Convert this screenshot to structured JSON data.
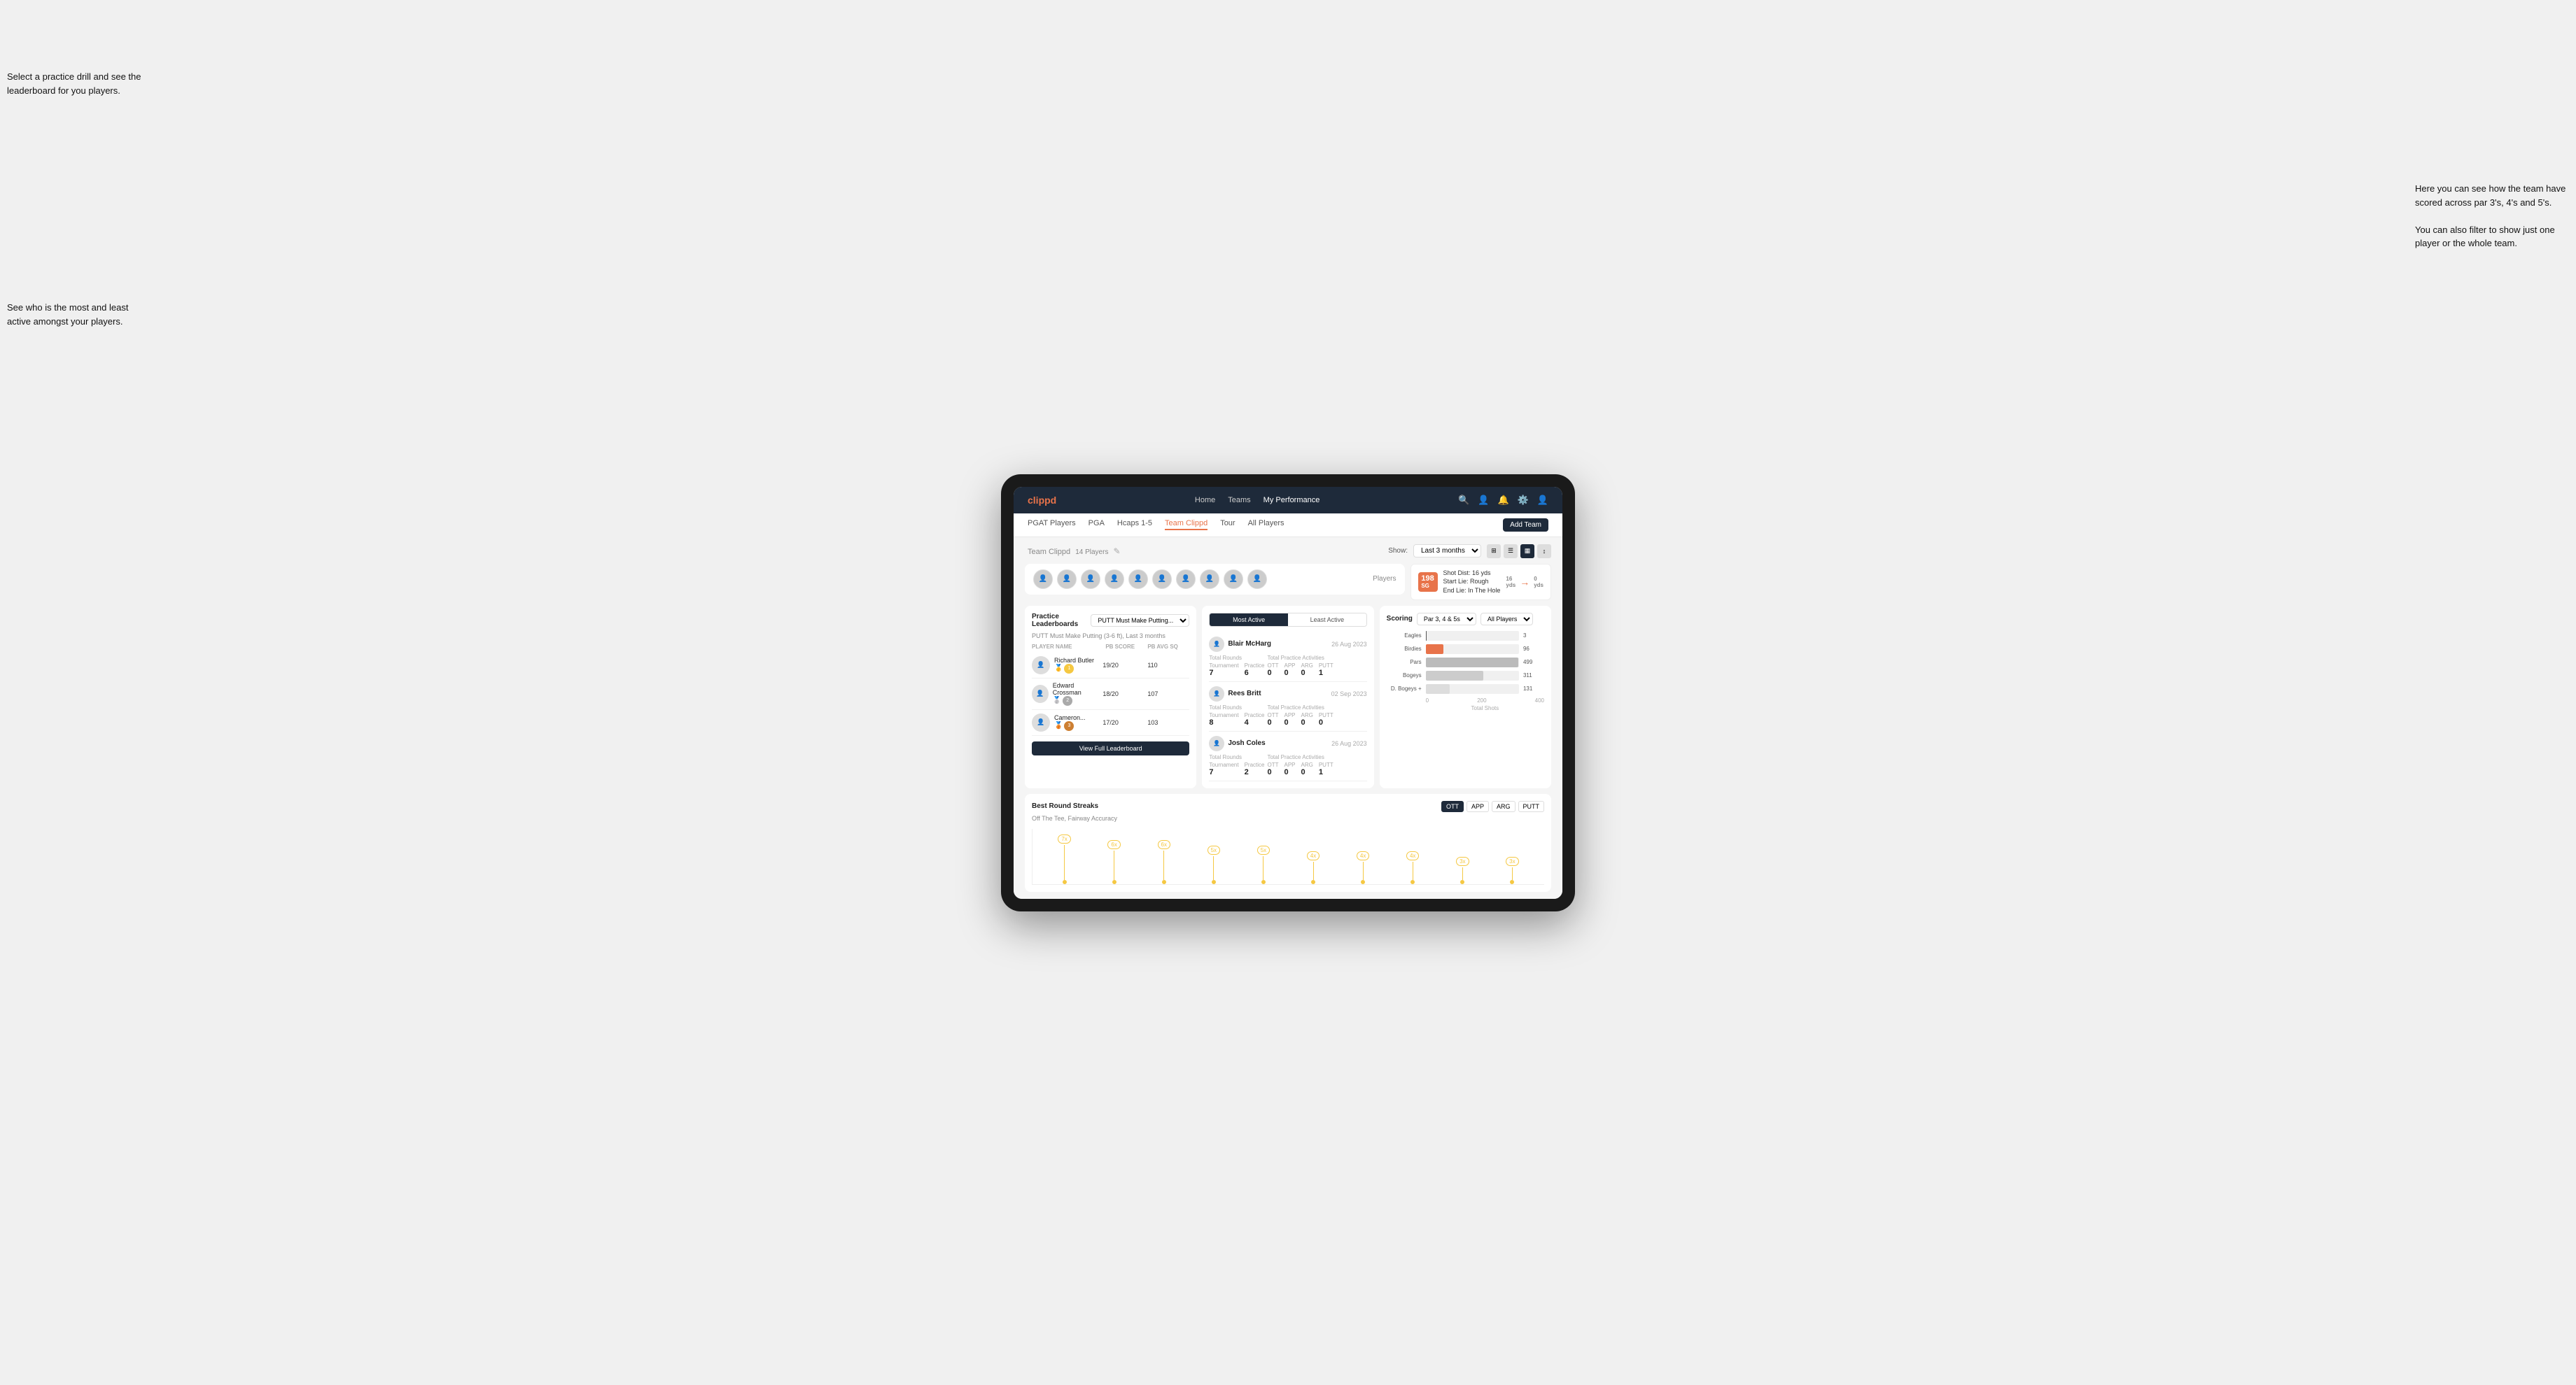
{
  "annotations": {
    "top_left": "Select a practice drill and see\nthe leaderboard for you players.",
    "bottom_left": "See who is the most and least\nactive amongst your players.",
    "right_top": "Here you can see how the\nteam have scored across\npar 3's, 4's and 5's.",
    "right_bottom": "You can also filter to show\njust one player or the whole\nteam."
  },
  "nav": {
    "logo": "clippd",
    "links": [
      "Home",
      "Teams",
      "My Performance"
    ],
    "icons": [
      "search",
      "person",
      "bell",
      "settings",
      "user"
    ]
  },
  "subnav": {
    "links": [
      "PGAT Players",
      "PGA",
      "Hcaps 1-5",
      "Team Clippd",
      "Tour",
      "All Players"
    ],
    "active": "Team Clippd",
    "add_team_label": "Add Team"
  },
  "team_header": {
    "title": "Team Clippd",
    "count": "14 Players",
    "show_label": "Show:",
    "show_value": "Last 3 months",
    "players_label": "Players"
  },
  "shot_info": {
    "badge": "198",
    "badge_sub": "SG",
    "line1": "Shot Dist: 16 yds",
    "line2": "Start Lie: Rough",
    "line3": "End Lie: In The Hole",
    "num1": "16",
    "num1_label": "yds",
    "num2": "0",
    "num2_label": "yds"
  },
  "practice_leaderboards": {
    "title": "Practice Leaderboards",
    "dropdown": "PUTT Must Make Putting...",
    "sub_info": "PUTT Must Make Putting (3-6 ft), Last 3 months",
    "headers": [
      "PLAYER NAME",
      "PB SCORE",
      "PB AVG SQ"
    ],
    "rows": [
      {
        "name": "Richard Butler",
        "score": "19/20",
        "avg": "110",
        "rank": 1,
        "rank_type": "gold"
      },
      {
        "name": "Edward Crossman",
        "score": "18/20",
        "avg": "107",
        "rank": 2,
        "rank_type": "silver"
      },
      {
        "name": "Cameron...",
        "score": "17/20",
        "avg": "103",
        "rank": 3,
        "rank_type": "bronze"
      }
    ],
    "view_full_label": "View Full Leaderboard"
  },
  "active_section": {
    "tab_most": "Most Active",
    "tab_least": "Least Active",
    "active_tab": "Most Active",
    "players": [
      {
        "name": "Blair McHarg",
        "date": "26 Aug 2023",
        "total_rounds_label": "Total Rounds",
        "tournament": "7",
        "practice": "6",
        "practice_activities_label": "Total Practice Activities",
        "ott": "0",
        "app": "0",
        "arg": "0",
        "putt": "1"
      },
      {
        "name": "Rees Britt",
        "date": "02 Sep 2023",
        "total_rounds_label": "Total Rounds",
        "tournament": "8",
        "practice": "4",
        "practice_activities_label": "Total Practice Activities",
        "ott": "0",
        "app": "0",
        "arg": "0",
        "putt": "0"
      },
      {
        "name": "Josh Coles",
        "date": "26 Aug 2023",
        "total_rounds_label": "Total Rounds",
        "tournament": "7",
        "practice": "2",
        "practice_activities_label": "Total Practice Activities",
        "ott": "0",
        "app": "0",
        "arg": "0",
        "putt": "1"
      }
    ]
  },
  "scoring": {
    "title": "Scoring",
    "filter1": "Par 3, 4 & 5s",
    "filter2": "All Players",
    "bars": [
      {
        "label": "Eagles",
        "value": 3,
        "max": 500,
        "color": "#555"
      },
      {
        "label": "Birdies",
        "value": 96,
        "max": 500,
        "color": "#e8734a"
      },
      {
        "label": "Pars",
        "value": 499,
        "max": 500,
        "color": "#bbb"
      },
      {
        "label": "Bogeys",
        "value": 311,
        "max": 500,
        "color": "#ccc"
      },
      {
        "label": "D. Bogeys +",
        "value": 131,
        "max": 500,
        "color": "#ddd"
      }
    ],
    "axis_labels": [
      "0",
      "200",
      "400"
    ],
    "x_label": "Total Shots"
  },
  "streaks": {
    "title": "Best Round Streaks",
    "subtitle": "Off The Tee, Fairway Accuracy",
    "buttons": [
      "OTT",
      "APP",
      "ARG",
      "PUTT"
    ],
    "active_button": "OTT",
    "dot_labels": [
      "7x",
      "6x",
      "6x",
      "5x",
      "5x",
      "4x",
      "4x",
      "4x",
      "3x",
      "3x"
    ]
  }
}
